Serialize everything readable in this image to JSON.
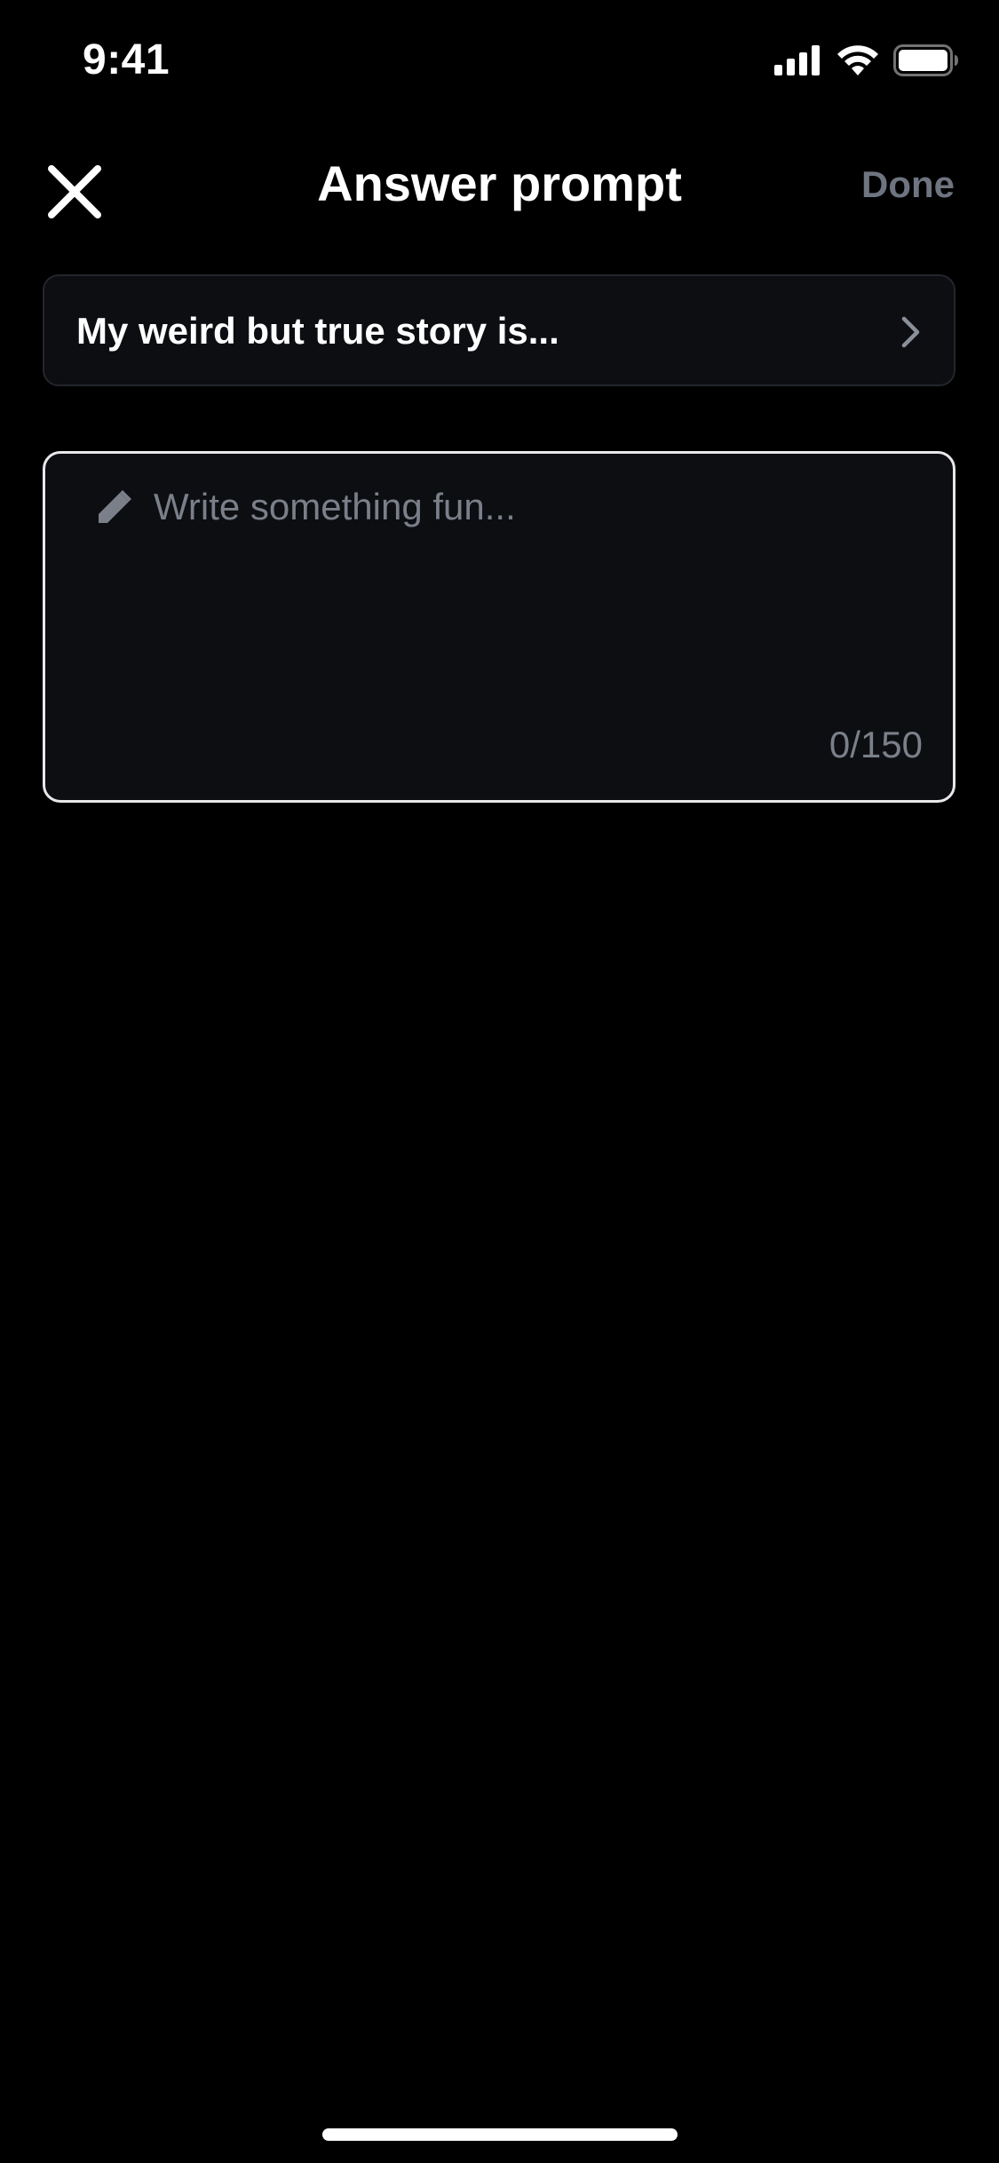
{
  "status_bar": {
    "time": "9:41",
    "icons": [
      "cellular-signal-icon",
      "wifi-icon",
      "battery-icon"
    ]
  },
  "header": {
    "close_icon": "close-icon",
    "title": "Answer prompt",
    "done_label": "Done"
  },
  "prompt": {
    "text": "My weird but true story is...",
    "chevron_icon": "chevron-right-icon"
  },
  "answer": {
    "icon": "pencil-icon",
    "value": "",
    "placeholder": "Write something fun...",
    "char_count": "0/150"
  },
  "colors": {
    "background": "#000000",
    "surface": "#0c0e12",
    "muted_text": "#7a7f89",
    "done_disabled": "#6e7480",
    "input_border": "#e8e8ea"
  }
}
